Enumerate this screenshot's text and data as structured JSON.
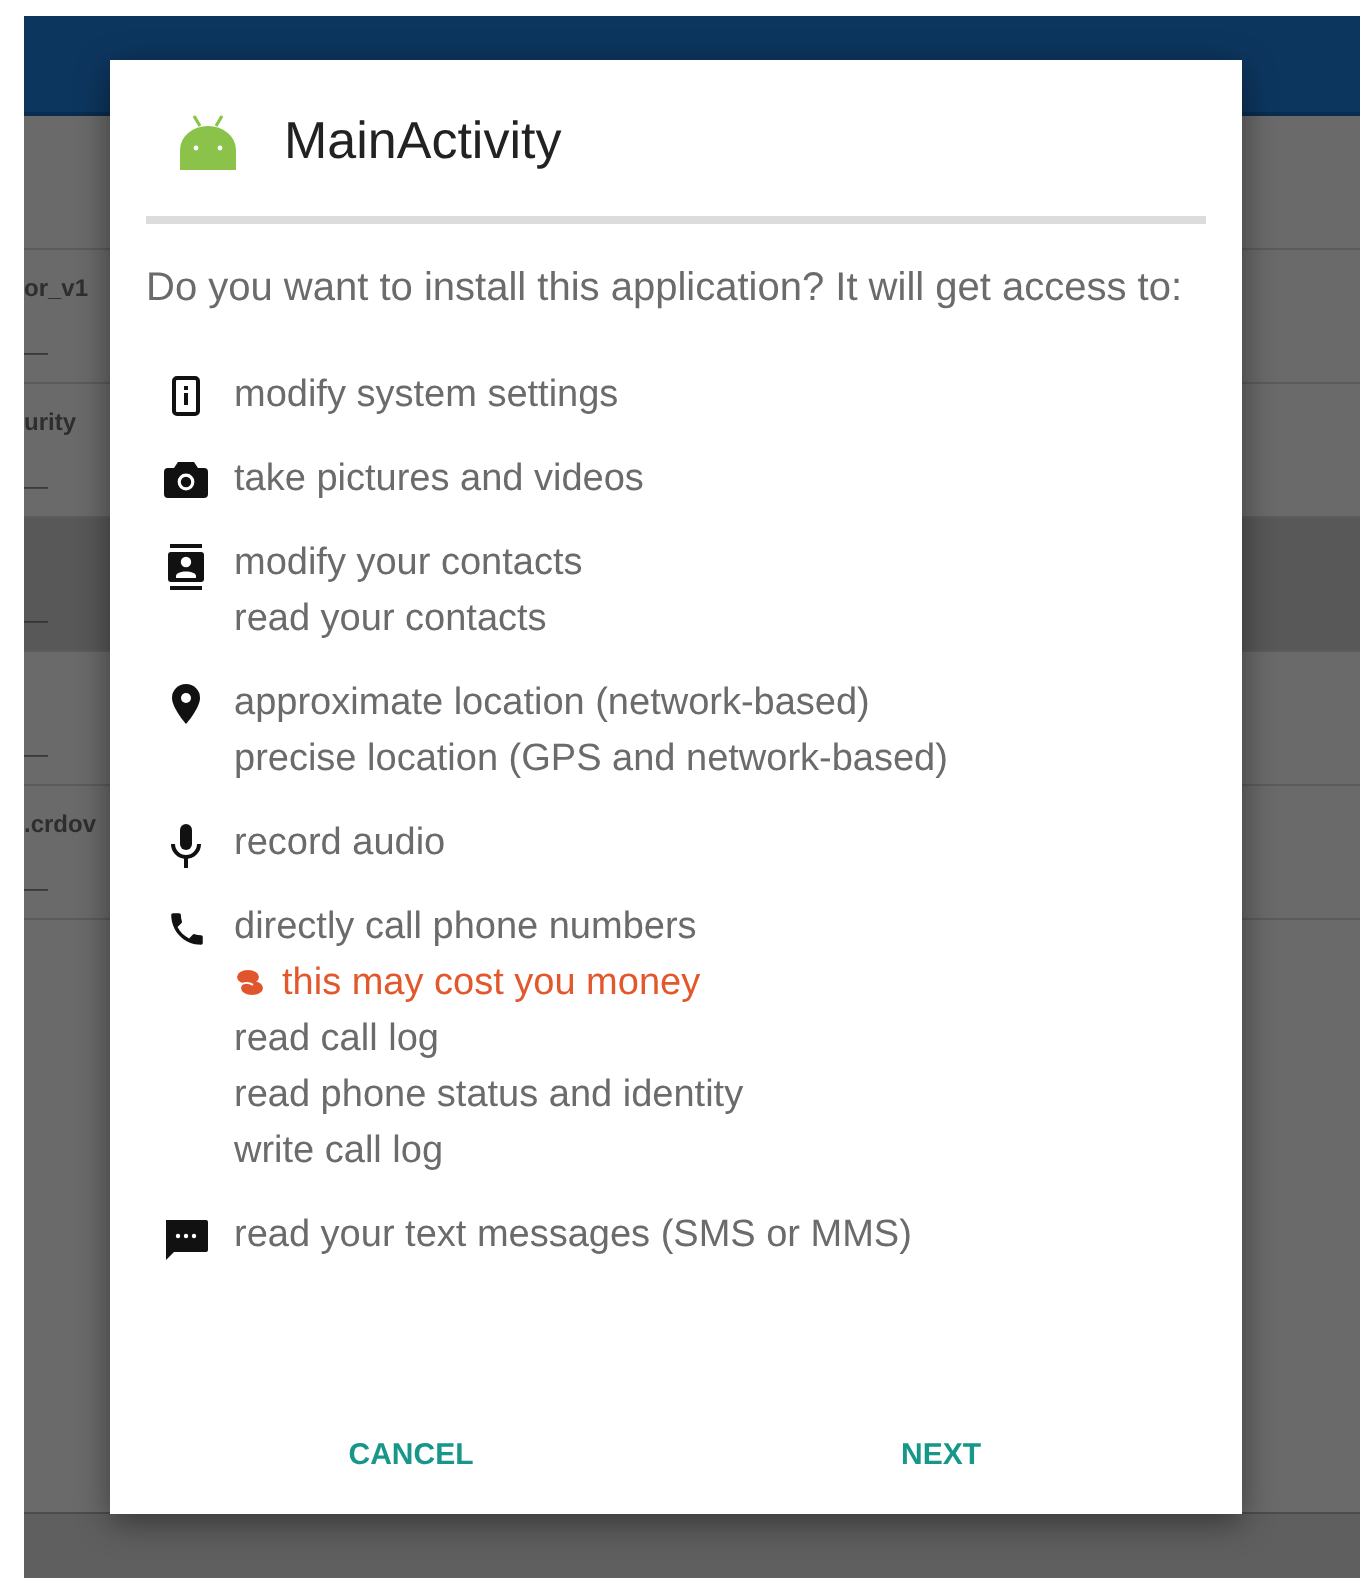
{
  "background_list": {
    "rows": [
      {
        "title": "",
        "subtitle": "",
        "selected": false
      },
      {
        "title": "or_v1",
        "subtitle": "—",
        "selected": false
      },
      {
        "title": "urity",
        "subtitle": "—",
        "selected": false
      },
      {
        "title": "",
        "subtitle": "—",
        "selected": true
      },
      {
        "title": "",
        "subtitle": "—",
        "selected": false
      },
      {
        "title": ".crdov",
        "subtitle": "—",
        "selected": false
      }
    ]
  },
  "dialog": {
    "title": "MainActivity",
    "message": "Do you want to install this application? It will get access to:",
    "permissions": [
      {
        "kind": "settings",
        "lines": [
          {
            "kind": "normal",
            "text": "modify system settings"
          }
        ]
      },
      {
        "kind": "camera",
        "lines": [
          {
            "kind": "normal",
            "text": "take pictures and videos"
          }
        ]
      },
      {
        "kind": "contacts",
        "lines": [
          {
            "kind": "normal",
            "text": "modify your contacts"
          },
          {
            "kind": "normal",
            "text": "read your contacts"
          }
        ]
      },
      {
        "kind": "location",
        "lines": [
          {
            "kind": "normal",
            "text": "approximate location (network-based)"
          },
          {
            "kind": "normal",
            "text": "precise location (GPS and network-based)"
          }
        ]
      },
      {
        "kind": "microphone",
        "lines": [
          {
            "kind": "normal",
            "text": "record audio"
          }
        ]
      },
      {
        "kind": "phone",
        "lines": [
          {
            "kind": "normal",
            "text": "directly call phone numbers"
          },
          {
            "kind": "warning",
            "text": "this may cost you money"
          },
          {
            "kind": "normal",
            "text": "read call log"
          },
          {
            "kind": "normal",
            "text": "read phone status and identity"
          },
          {
            "kind": "normal",
            "text": "write call log"
          }
        ]
      },
      {
        "kind": "message",
        "lines": [
          {
            "kind": "normal",
            "text": "read your text messages (SMS or MMS)"
          }
        ]
      }
    ],
    "buttons": [
      "CANCEL",
      "NEXT"
    ]
  }
}
